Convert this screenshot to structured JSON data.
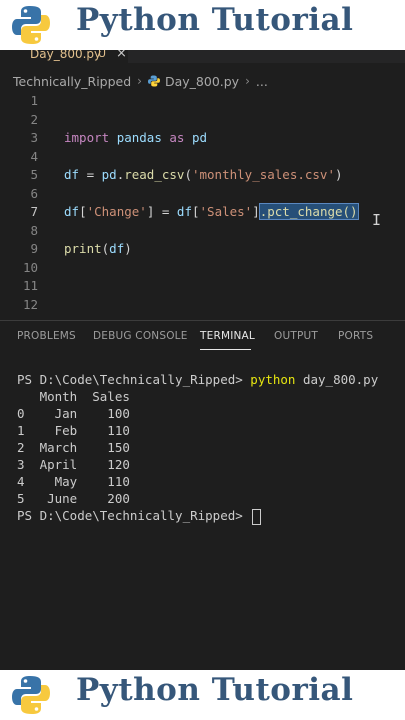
{
  "banner": {
    "title": "Python Tutorial"
  },
  "tab": {
    "filename": "Day_800.py",
    "badge": "U",
    "close": "×"
  },
  "breadcrumb": {
    "folder": "Technically_Ripped",
    "file": "Day_800.py",
    "trail": "..."
  },
  "editor": {
    "line_numbers": [
      "1",
      "2",
      "3",
      "4",
      "5",
      "6",
      "7",
      "8",
      "9",
      "10",
      "11",
      "12"
    ],
    "line3": {
      "import": "import",
      "mod": "pandas",
      "as": "as",
      "alias": "pd"
    },
    "line5": {
      "df": "df",
      "eq": " = ",
      "pd": "pd",
      "dot": ".",
      "fn": "read_csv",
      "open": "(",
      "arg": "'monthly_sales.csv'",
      "close": ")"
    },
    "line7": {
      "df": "df",
      "b1": "[",
      "key": "'Change'",
      "b2": "] = ",
      "df2": "df",
      "b3": "[",
      "key2": "'Sales'",
      "b4": "]",
      "selected": ".pct_change()"
    },
    "line9": {
      "fn": "print",
      "open": "(",
      "arg": "df",
      "close": ")"
    }
  },
  "panel": {
    "tabs": [
      "PROBLEMS",
      "DEBUG CONSOLE",
      "TERMINAL",
      "OUTPUT",
      "PORTS"
    ],
    "active_tab": "TERMINAL"
  },
  "terminal": {
    "prompt": "PS D:\\Code\\Technically_Ripped> ",
    "command": "python",
    "command_arg": " day_800.py",
    "output": [
      "   Month  Sales",
      "0    Jan    100",
      "1    Feb    110",
      "2  March    150",
      "3  April    120",
      "4    May    110",
      "5   June    200"
    ],
    "final_prompt": "PS D:\\Code\\Technically_Ripped> "
  },
  "colors": {
    "banner_title": "#36577a",
    "python_blue": "#3873a8",
    "python_yellow": "#f7c93e",
    "selection": "#264f78"
  }
}
